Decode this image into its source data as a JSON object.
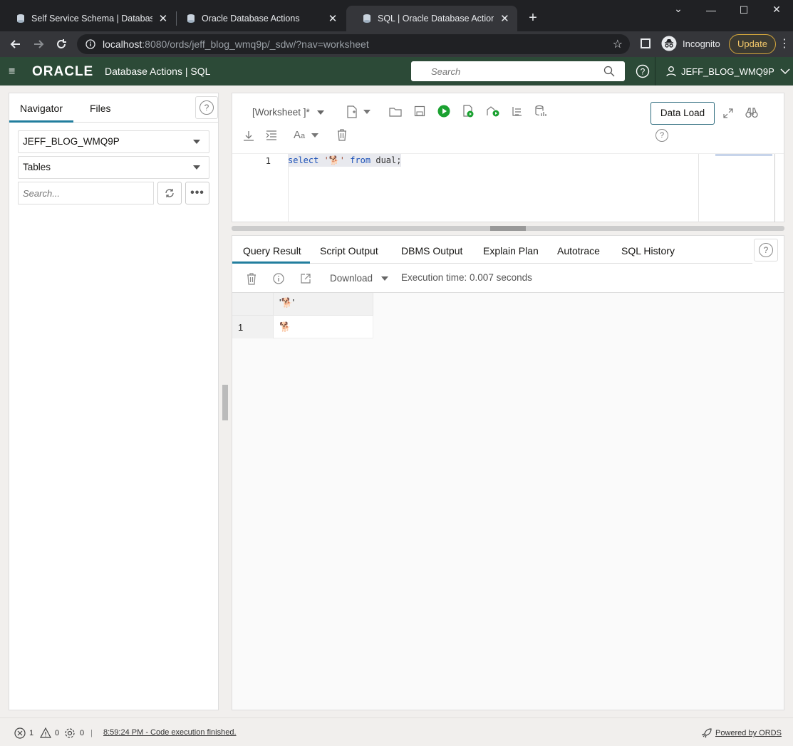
{
  "browser": {
    "tabs": [
      {
        "title": "Self Service Schema | Database U"
      },
      {
        "title": "Oracle Database Actions"
      },
      {
        "title": "SQL | Oracle Database Actions"
      }
    ],
    "url_host": "localhost",
    "url_rest": ":8080/ords/jeff_blog_wmq9p/_sdw/?nav=worksheet",
    "incognito_label": "Incognito",
    "update_label": "Update"
  },
  "app": {
    "logo": "ORACLE",
    "product": "Database Actions |  SQL",
    "search_placeholder": "Search",
    "user": "JEFF_BLOG_WMQ9P",
    "colors": {
      "header": "#2c4a37",
      "accent": "#227e9e"
    }
  },
  "navigator": {
    "tabs": [
      "Navigator",
      "Files"
    ],
    "schema": "JEFF_BLOG_WMQ9P",
    "object_type": "Tables",
    "search_placeholder": "Search..."
  },
  "worksheet": {
    "name": "[Worksheet ]*",
    "data_load_label": "Data Load",
    "line_number": "1",
    "code": {
      "kw1": "select",
      "str": "'🐕'",
      "kw2": "from",
      "rest": "dual;"
    }
  },
  "results": {
    "tabs": [
      "Query Result",
      "Script Output",
      "DBMS Output",
      "Explain Plan",
      "Autotrace",
      "SQL History"
    ],
    "download_label": "Download",
    "execution_time": "Execution time: 0.007 seconds",
    "columns": [
      "'🐕'"
    ],
    "rows": [
      {
        "num": "1",
        "value": "🐕"
      }
    ]
  },
  "status": {
    "errors": "1",
    "warnings": "0",
    "settings": "0",
    "message": "8:59:24 PM - Code execution finished.",
    "powered": "Powered by ORDS"
  }
}
